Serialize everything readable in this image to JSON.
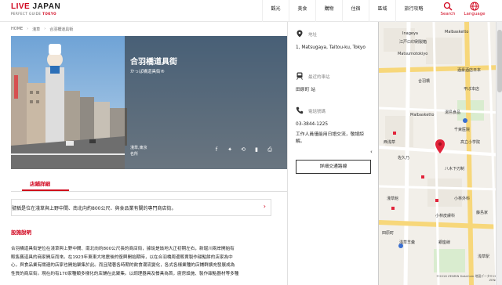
{
  "header": {
    "logo_live": "LIVE",
    "logo_japan": " JAPAN",
    "logo_tagline": "PERFECT GUIDE",
    "logo_city": "TOKYO",
    "nav": [
      "觀光",
      "美食",
      "購物",
      "住宿",
      "區域",
      "旅行攻略"
    ],
    "search_label": "Search",
    "language_label": "Language"
  },
  "breadcrumb": [
    "HOME",
    "淺草",
    "合羽橋道具街"
  ],
  "hero": {
    "title": "合羽橋道具街",
    "subtitle": "かっぱ橋道具街®",
    "area_line1": "淺草,東京",
    "area_line2": "名所"
  },
  "tab": {
    "active": "店鋪詳細"
  },
  "summary": "號稱是位在淺草與上野中間、南北向約800公尺、與食品業有關的專門商店街。",
  "section": {
    "title": "設施說明",
    "lines": [
      "合羽橋道具街是位在淺草與上野中間、南北向約800公尺長的商店街，據說是該地大正初期左右，新堀川兩岸開始有",
      "販售舊道具的商家開店而來。在1923年東東大地震後的復興開始期時，以在合羽橋周邊販賣製作甜點餅的店家為中",
      "心，與食品業有關連的店家也開始聚集於此。而且隨著各時期的飲食潮流變化，各式各樣業種的店鋪群擴充發展成為",
      "性質的商店街。現在約有170家種類多樣化的店鋪在此聚集。以調理器具及餐具為首，廚房設施、製作甜點器材等多種"
    ]
  },
  "panel": {
    "address_label": "地址",
    "address_value": "1, Matsugaya, Taitou-ku, Tokyo",
    "station_label": "最近的車站",
    "station_value": "田原町 站",
    "phone_label": "電話號碼",
    "phone_value": "03-3844-1225",
    "phone_note": "工作人員僅能用日語交流，敬請諒解。",
    "button": "詳細交通路線",
    "collapse": "‹"
  },
  "map": {
    "labels": [
      "Inageya",
      "江戸ロ印刷製箱",
      "Matsumotokiyo",
      "Malbasketto",
      "酒豪酒店日本",
      "合羽橋",
      "平ぼ本店",
      "湯島食品",
      "千束医院",
      "Malbasketto",
      "西浅草",
      "佐久乃",
      "高立小学院",
      "八木下刃制",
      "淺草館",
      "小林外科",
      "浅草羊羹",
      "藤島家",
      "小林皮膚科",
      "浅草駅",
      "銀座線",
      "田原町"
    ],
    "copyright": "©2016 ZENRIN DataCom 地図データ©2016 ZENRIN"
  },
  "colors": {
    "accent": "#d0021b"
  }
}
